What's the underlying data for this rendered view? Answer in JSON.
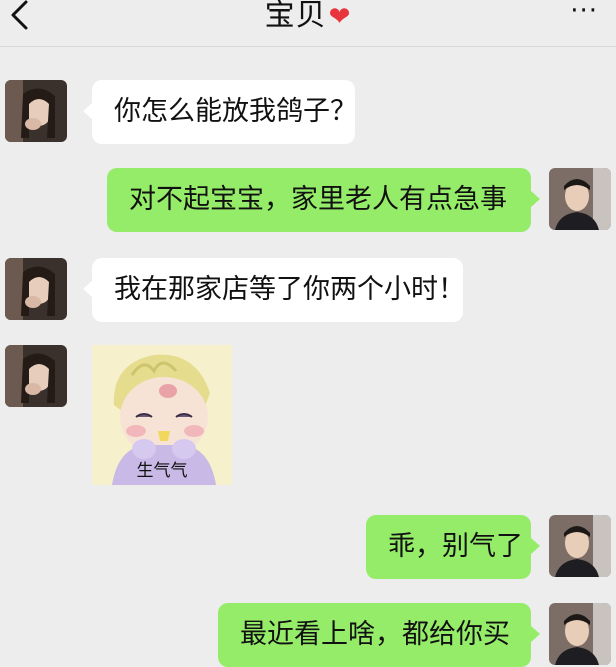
{
  "header": {
    "title": "宝贝",
    "title_emoji": "❤",
    "more_label": "···"
  },
  "messages": [
    {
      "side": "in",
      "type": "text",
      "text": "你怎么能放我鸽子？"
    },
    {
      "side": "out",
      "type": "text",
      "text": "对不起宝宝，家里老人有点急事"
    },
    {
      "side": "in",
      "type": "text",
      "text": "我在那家店等了你两个小时！"
    },
    {
      "side": "in",
      "type": "sticker",
      "caption": "生气气"
    },
    {
      "side": "out",
      "type": "text",
      "text": "乖，别气了"
    },
    {
      "side": "out",
      "type": "text",
      "text": "最近看上啥，都给你买"
    }
  ],
  "colors": {
    "background": "#ededed",
    "incoming_bubble": "#ffffff",
    "outgoing_bubble": "#95ec69",
    "heart": "#e8353b"
  }
}
